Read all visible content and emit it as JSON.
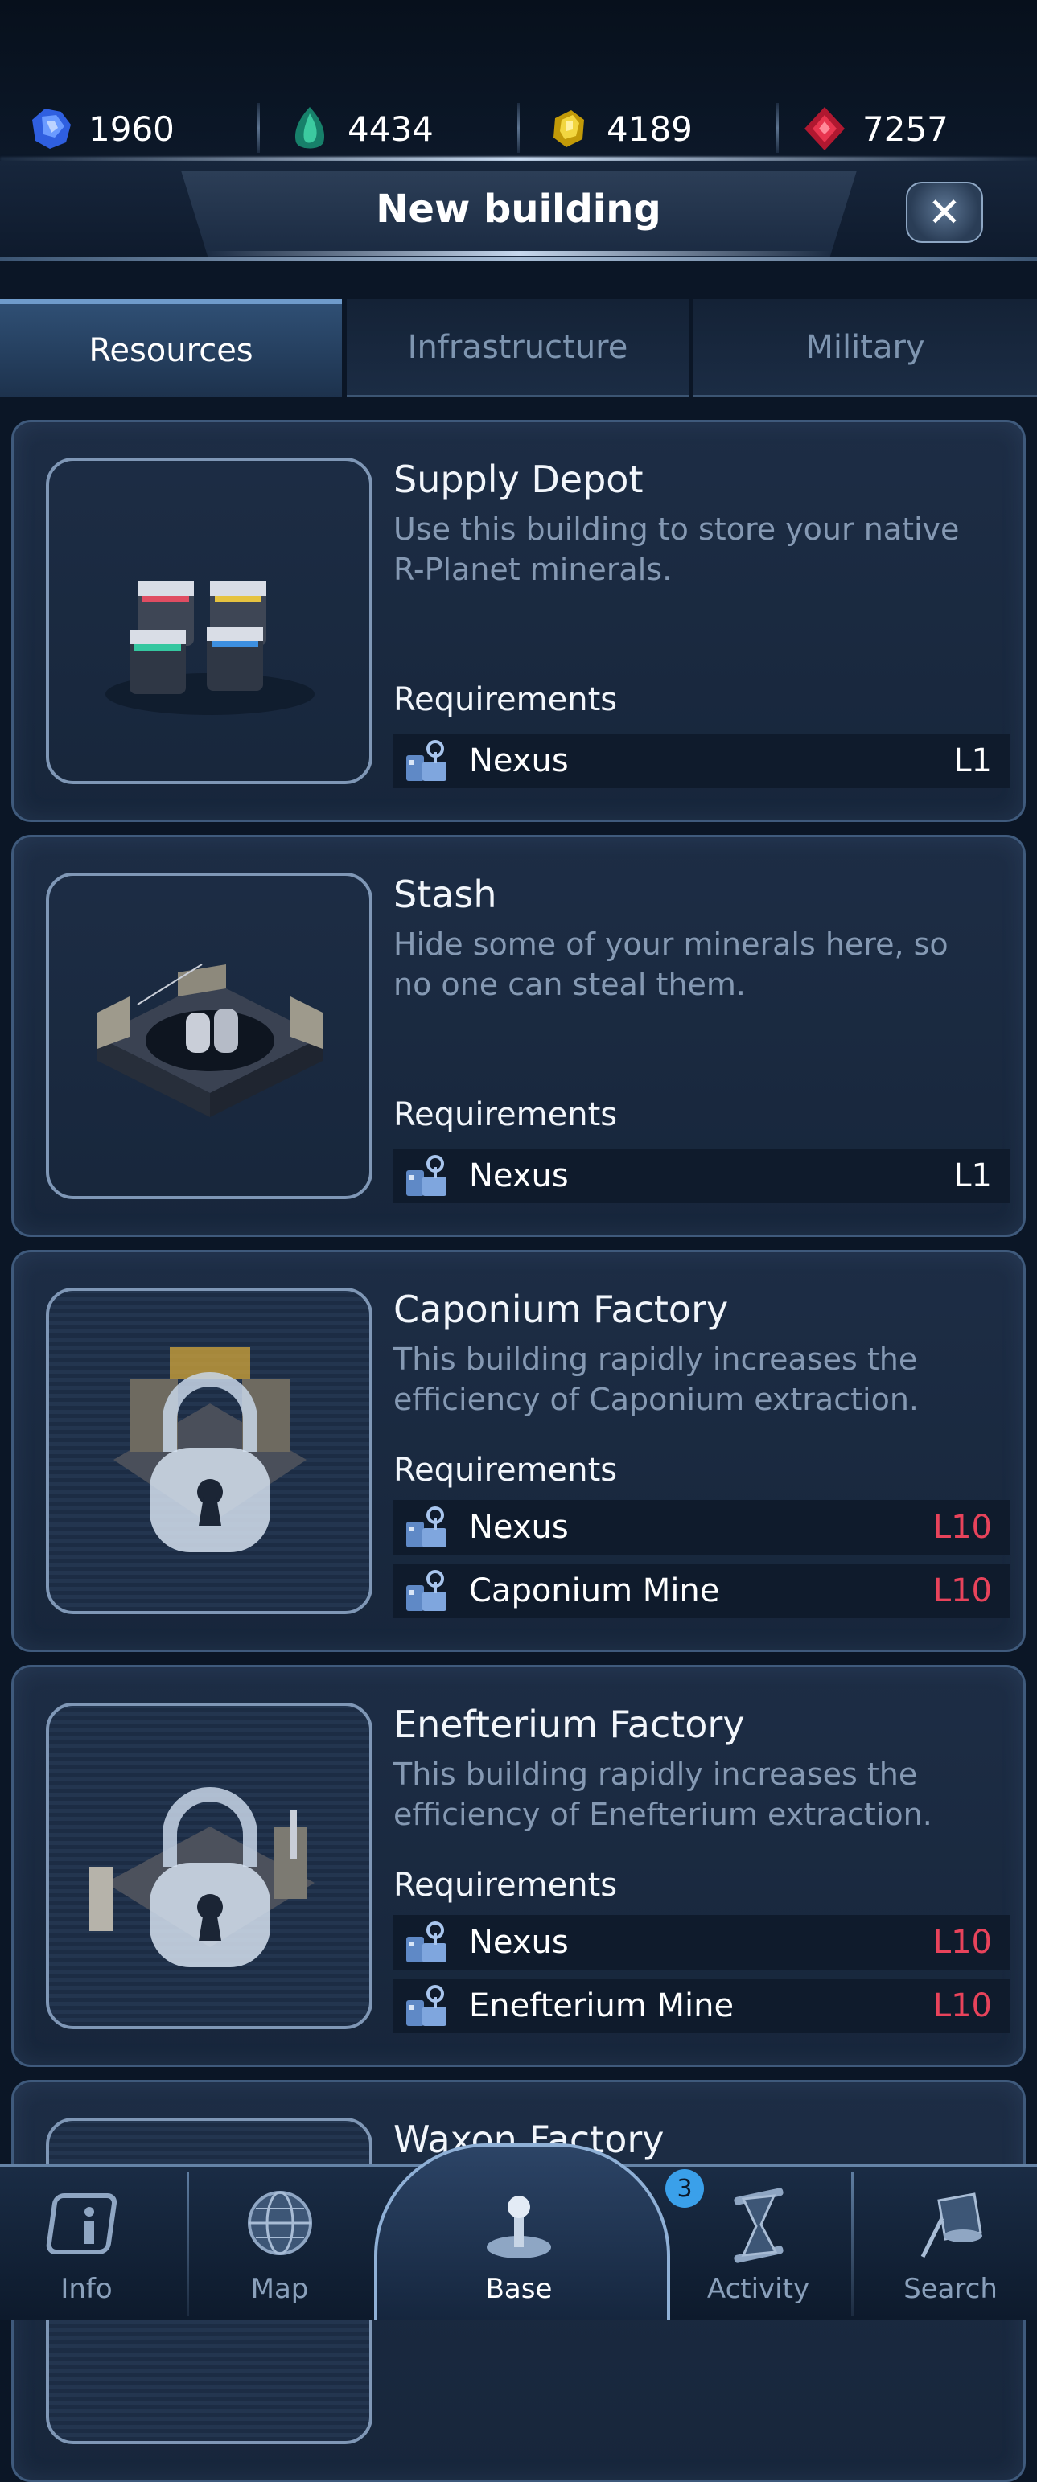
{
  "resources": [
    {
      "name": "blue-crystal",
      "value": "1960",
      "color": "#3f6ff0"
    },
    {
      "name": "green-crystal",
      "value": "4434",
      "color": "#2bb08a"
    },
    {
      "name": "yellow-crystal",
      "value": "4189",
      "color": "#e0bf1b"
    },
    {
      "name": "red-crystal",
      "value": "7257",
      "color": "#d92a44"
    }
  ],
  "header": {
    "title": "New building",
    "close_icon": "close-icon"
  },
  "tabs": [
    {
      "label": "Resources",
      "active": true
    },
    {
      "label": "Infrastructure",
      "active": false
    },
    {
      "label": "Military",
      "active": false
    }
  ],
  "buildings": [
    {
      "name": "Supply Depot",
      "description": "Use this building to store your native R-Planet minerals.",
      "requirements_label": "Requirements",
      "locked": false,
      "requirements": [
        {
          "name": "Nexus",
          "level": "L1",
          "met": true
        }
      ]
    },
    {
      "name": "Stash",
      "description": "Hide some of your minerals here, so no one can steal them.",
      "requirements_label": "Requirements",
      "locked": false,
      "requirements": [
        {
          "name": "Nexus",
          "level": "L1",
          "met": true
        }
      ]
    },
    {
      "name": "Caponium Factory",
      "description": "This building rapidly increases the efficiency of Caponium extraction.",
      "requirements_label": "Requirements",
      "locked": true,
      "requirements": [
        {
          "name": "Nexus",
          "level": "L10",
          "met": false
        },
        {
          "name": "Caponium Mine",
          "level": "L10",
          "met": false
        }
      ]
    },
    {
      "name": "Enefterium Factory",
      "description": "This building rapidly increases the efficiency of Enefterium extraction.",
      "requirements_label": "Requirements",
      "locked": true,
      "requirements": [
        {
          "name": "Nexus",
          "level": "L10",
          "met": false
        },
        {
          "name": "Enefterium Mine",
          "level": "L10",
          "met": false
        }
      ]
    },
    {
      "name": "Waxon Factory",
      "description": "",
      "requirements_label": "",
      "locked": true,
      "requirements": []
    }
  ],
  "nav": [
    {
      "label": "Info",
      "icon": "info-icon",
      "active": false
    },
    {
      "label": "Map",
      "icon": "globe-icon",
      "active": false
    },
    {
      "label": "Base",
      "icon": "joystick-icon",
      "active": true
    },
    {
      "label": "Activity",
      "icon": "hourglass-icon",
      "active": false,
      "badge": "3"
    },
    {
      "label": "Search",
      "icon": "telescope-icon",
      "active": false
    }
  ],
  "colors": {
    "unmet_level": "#e8435b",
    "met_level": "#ffffff",
    "accent": "#6f9bcb"
  }
}
